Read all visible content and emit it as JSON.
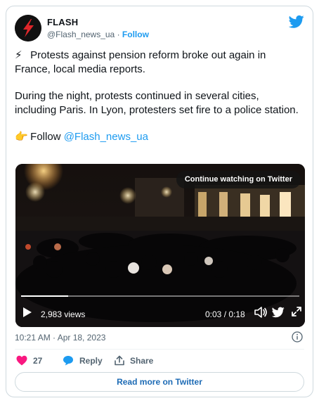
{
  "author": {
    "name": "FLASH",
    "handle": "@Flash_news_ua",
    "separator": "·",
    "follow_label": "Follow",
    "avatar_icon": "lightning-logo-icon",
    "avatar_colors": {
      "bg": "#111111",
      "bolt": "#e0262a"
    }
  },
  "tweet": {
    "emoji_1": "⚡",
    "paragraph_1": "Protests against pension reform broke out again in France, local media reports.",
    "paragraph_2": "During the night, protests continued in several cities, including Paris. In Lyon, protesters set fire to a police station.",
    "emoji_2": "👉",
    "follow_prefix": "Follow ",
    "follow_link": "@Flash_news_ua"
  },
  "video": {
    "continue_label": "Continue watching on Twitter",
    "views": "2,983 views",
    "time": "0:03 / 0:18",
    "progress_fraction": 0.17
  },
  "timestamp": "10:21 AM · Apr 18, 2023",
  "actions": {
    "likes": "27",
    "reply_label": "Reply",
    "share_label": "Share"
  },
  "read_more_label": "Read more on Twitter",
  "colors": {
    "accent": "#1d9bf0",
    "like": "#f91880",
    "text": "#0f1419",
    "muted": "#536471"
  }
}
